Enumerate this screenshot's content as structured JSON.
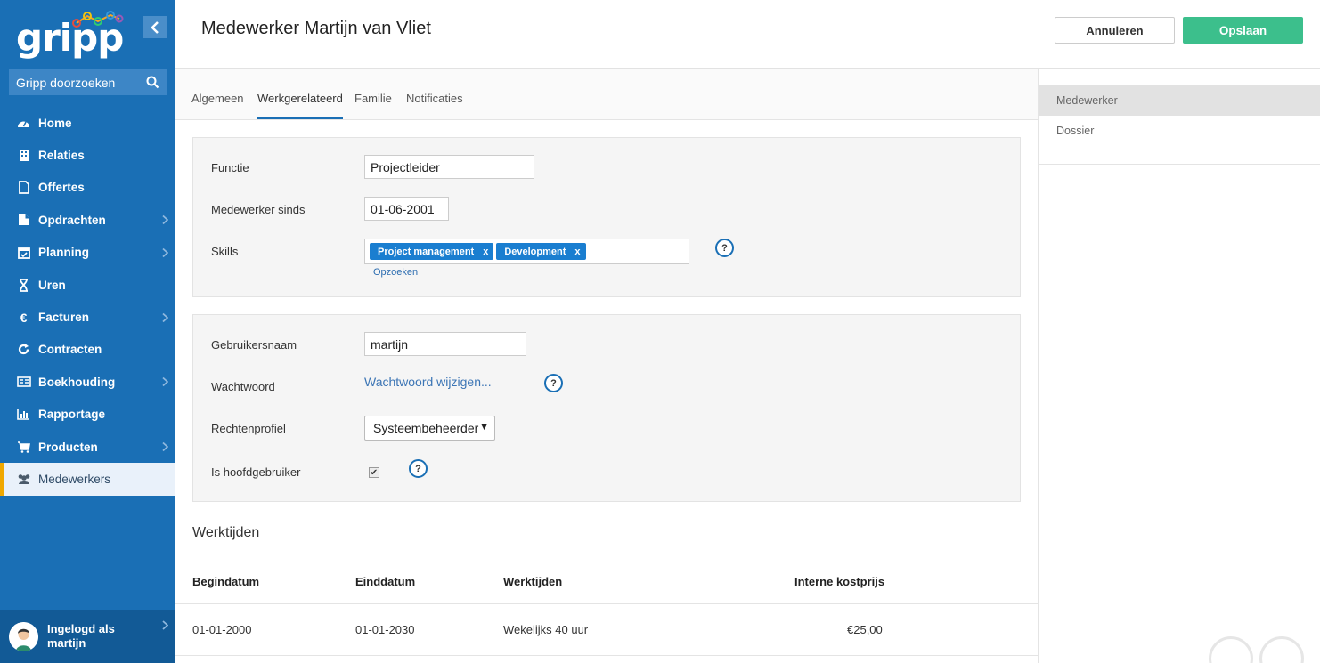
{
  "app": {
    "logo_text": "gripp",
    "search_placeholder": "Gripp doorzoeken"
  },
  "sidebar": {
    "items": [
      {
        "label": "Home",
        "icon": "dashboard-icon",
        "has_submenu": false
      },
      {
        "label": "Relaties",
        "icon": "building-icon",
        "has_submenu": false
      },
      {
        "label": "Offertes",
        "icon": "document-icon",
        "has_submenu": false
      },
      {
        "label": "Opdrachten",
        "icon": "briefcase-icon",
        "has_submenu": true
      },
      {
        "label": "Planning",
        "icon": "calendar-check-icon",
        "has_submenu": true
      },
      {
        "label": "Uren",
        "icon": "hourglass-icon",
        "has_submenu": false
      },
      {
        "label": "Facturen",
        "icon": "euro-icon",
        "has_submenu": true
      },
      {
        "label": "Contracten",
        "icon": "refresh-icon",
        "has_submenu": false
      },
      {
        "label": "Boekhouding",
        "icon": "ledger-icon",
        "has_submenu": true
      },
      {
        "label": "Rapportage",
        "icon": "bar-chart-icon",
        "has_submenu": false
      },
      {
        "label": "Producten",
        "icon": "cart-icon",
        "has_submenu": true
      },
      {
        "label": "Medewerkers",
        "icon": "users-icon",
        "has_submenu": false,
        "active": true
      }
    ],
    "user": {
      "line1": "Ingelogd als",
      "line2": "martijn"
    }
  },
  "header": {
    "title": "Medewerker Martijn van Vliet",
    "cancel_label": "Annuleren",
    "save_label": "Opslaan"
  },
  "tabs": [
    {
      "label": "Algemeen",
      "active": false
    },
    {
      "label": "Werkgerelateerd",
      "active": true
    },
    {
      "label": "Familie",
      "active": false
    },
    {
      "label": "Notificaties",
      "active": false
    }
  ],
  "form1": {
    "functie_label": "Functie",
    "functie_value": "Projectleider",
    "sinds_label": "Medewerker sinds",
    "sinds_value": "01-06-2001",
    "skills_label": "Skills",
    "skills": [
      {
        "label": "Project management",
        "remove": "x"
      },
      {
        "label": "Development",
        "remove": "x"
      }
    ],
    "lookup_label": "Opzoeken"
  },
  "form2": {
    "username_label": "Gebruikersnaam",
    "username_value": "martijn",
    "password_label": "Wachtwoord",
    "password_link": "Wachtwoord wijzigen...",
    "rights_label": "Rechtenprofiel",
    "rights_value": "Systeembeheerder",
    "main_user_label": "Is hoofdgebruiker",
    "main_user_checked": true
  },
  "help_symbol": "?",
  "worktimes": {
    "title": "Werktijden",
    "columns": [
      "Begindatum",
      "Einddatum",
      "Werktijden",
      "Interne kostprijs"
    ],
    "rows": [
      [
        "01-01-2000",
        "01-01-2030",
        "Wekelijks 40 uur",
        "€25,00"
      ]
    ]
  },
  "right_panel": {
    "items": [
      {
        "label": "Medewerker",
        "active": true
      },
      {
        "label": "Dossier",
        "active": false
      }
    ]
  },
  "colors": {
    "sidebar": "#1a6fb5",
    "accent_green": "#3cbf8c",
    "active_indicator": "#f0a800",
    "tag": "#1a7ed0"
  }
}
